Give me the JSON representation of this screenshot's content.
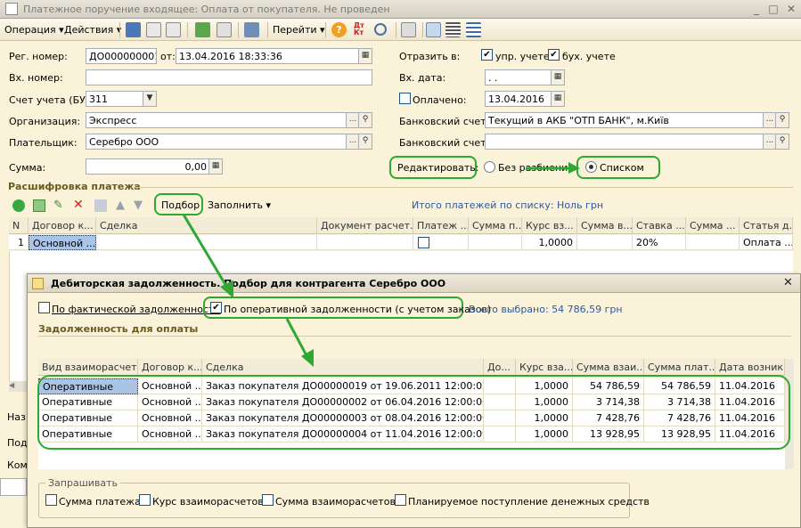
{
  "main_window": {
    "title": "Платежное поручение входящее: Оплата от покупателя. Не проведен",
    "toolbar": {
      "operation": "Операция",
      "actions": "Действия",
      "goto": "Перейти",
      "help": "?",
      "dt_kt": "Дт Кт"
    },
    "form": {
      "reg_number_label": "Рег. номер:",
      "reg_number": "ДО000000001",
      "from_label": "от:",
      "date": "13.04.2016 18:33:36",
      "reflect_label": "Отразить в:",
      "mgmt_label": "упр. учете",
      "acct_label": "бух. учете",
      "in_number_label": "Вх. номер:",
      "in_number": "",
      "in_date_label": "Вх. дата:",
      "in_date": " .  .",
      "account_label": "Счет учета (БУ):",
      "account": "311",
      "paid_label": "Оплачено:",
      "paid_date": "13.04.2016",
      "org_label": "Организация:",
      "org": "Экспресс",
      "bank_label": "Банковский счет:",
      "bank": "Текущий в АКБ \"ОТП БАНК\", м.Київ",
      "payer_label": "Плательщик:",
      "payer": "Серебро ООО",
      "bank2_label": "Банковский счет:",
      "bank2": "",
      "sum_label": "Сумма:",
      "sum": "0,00",
      "edit_label": "Редактировать:",
      "no_split": "Без разбиения",
      "by_list": "Списком"
    },
    "breakdown": {
      "title": "Расшифровка платежа",
      "pick": "Подбор",
      "fill": "Заполнить",
      "total": "Итого платежей по списку: Ноль грн",
      "columns": [
        "N",
        "Договор к...",
        "Сделка",
        "Документ расчет...",
        "Платеж ...",
        "Сумма п...",
        "Курс вз...",
        "Сумма в...",
        "Ставка ...",
        "Сумма ...",
        "Статья д..."
      ],
      "row": {
        "n": "1",
        "contract": "Основной ...",
        "rate": "1,0000",
        "vat": "20%",
        "article": "Оплата ..."
      }
    },
    "left_cut": [
      "Наз",
      "Под",
      "Ком"
    ]
  },
  "dialog": {
    "title": "Дебиторская задолженность. Подбор для контрагента Серебро ООО",
    "actual_debt": "По фактической задолженности",
    "operational_debt": "По оперативной задолженности (с учетом заказов)",
    "selected_total": "Всего выбрано: 54 786,59 грн",
    "section_title": "Задолженность для оплаты",
    "columns": [
      "Вид взаиморасчет...",
      "Договор к...",
      "Сделка",
      "До...",
      "Курс вза...",
      "Сумма взаи...",
      "Сумма плат...",
      "Дата возник..."
    ],
    "rows": [
      {
        "kind": "Оперативные",
        "contract": "Основной ...",
        "deal": "Заказ покупателя ДО00000019 от 19.06.2011 12:00:02",
        "rate": "1,0000",
        "sum": "54 786,59",
        "pay": "54 786,59",
        "date": "11.04.2016"
      },
      {
        "kind": "Оперативные",
        "contract": "Основной ...",
        "deal": "Заказ покупателя ДО00000002 от 06.04.2016 12:00:00",
        "rate": "1,0000",
        "sum": "3 714,38",
        "pay": "3 714,38",
        "date": "11.04.2016"
      },
      {
        "kind": "Оперативные",
        "contract": "Основной ...",
        "deal": "Заказ покупателя ДО00000003 от 08.04.2016 12:00:00",
        "rate": "1,0000",
        "sum": "7 428,76",
        "pay": "7 428,76",
        "date": "11.04.2016"
      },
      {
        "kind": "Оперативные",
        "contract": "Основной ...",
        "deal": "Заказ покупателя ДО00000004 от 11.04.2016 12:00:00",
        "rate": "1,0000",
        "sum": "13 928,95",
        "pay": "13 928,95",
        "date": "11.04.2016"
      }
    ],
    "ask": {
      "title": "Запрашивать",
      "pay_sum": "Сумма платежа",
      "rate": "Курс взаиморасчетов",
      "mutual_sum": "Сумма взаиморасчетов",
      "planned": "Планируемое поступление денежных средств"
    }
  },
  "colors": {
    "accent_green": "#2ea832",
    "form_bg": "#fbf3d9",
    "section_text": "#6b5a1e",
    "link": "#2d57a0",
    "selected_cell": "#a9c4e6"
  }
}
